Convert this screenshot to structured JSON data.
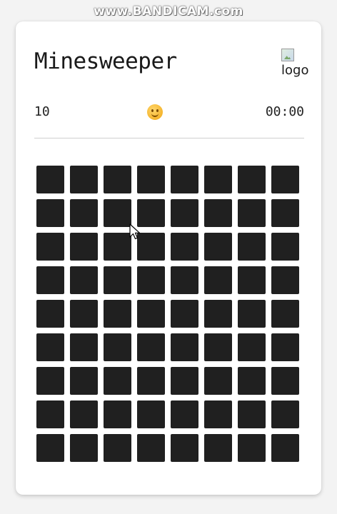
{
  "watermark": "www.BANDICAM.com",
  "game": {
    "title": "Minesweeper",
    "logo_alt": "logo",
    "mine_count": "10",
    "face_icon": "smiley-face-icon",
    "timer": "00:00"
  },
  "board": {
    "rows": 9,
    "cols": 8,
    "cell_state": "covered",
    "cell_color": "#202020"
  },
  "colors": {
    "card_background": "#ffffff",
    "page_background": "#f3f3f3",
    "face": "#f5b52e"
  }
}
